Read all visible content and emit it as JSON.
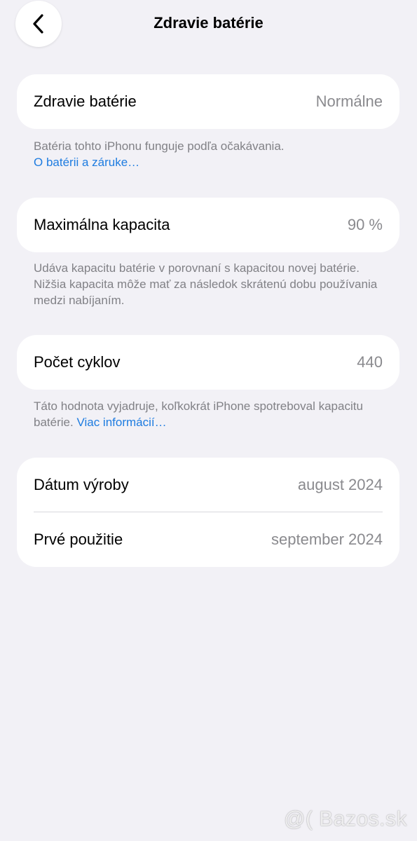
{
  "nav": {
    "title": "Zdravie batérie",
    "back_icon": "chevron-left-icon"
  },
  "battery_health": {
    "label": "Zdravie batérie",
    "value": "Normálne",
    "footnote": "Batéria tohto iPhonu funguje podľa očakávania.",
    "link": "O batérii a záruke…"
  },
  "max_capacity": {
    "label": "Maximálna kapacita",
    "value": "90 %",
    "footnote": "Udáva kapacitu batérie v porovnaní s kapacitou novej batérie. Nižšia kapacita môže mať za následok skrátenú dobu používania medzi nabíjaním."
  },
  "cycle_count": {
    "label": "Počet cyklov",
    "value": "440",
    "footnote": "Táto hodnota vyjadruje, koľkokrát iPhone spotreboval kapacitu batérie.",
    "link": "Viac informácií…"
  },
  "dates": {
    "manufacture_label": "Dátum výroby",
    "manufacture_value": "august 2024",
    "first_use_label": "Prvé použitie",
    "first_use_value": "september 2024"
  },
  "watermark": "@( Bazos.sk",
  "colors": {
    "background": "#f2f1f6",
    "card": "#ffffff",
    "link": "#1e7ce0",
    "secondary_text": "#8a8a8e"
  }
}
